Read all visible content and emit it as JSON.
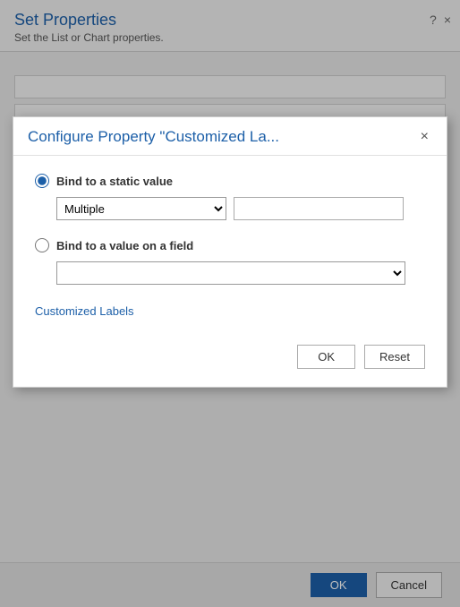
{
  "background": {
    "title": "Set Properties",
    "subtitle": "Set the List or Chart properties.",
    "help_icon": "?",
    "close_icon": "×",
    "ok_label": "OK",
    "cancel_label": "Cancel"
  },
  "modal": {
    "title": "Configure Property \"Customized La...",
    "close_icon": "×",
    "static_value_label": "Bind to a static value",
    "field_value_label": "Bind to a value on a field",
    "select_options": [
      "Multiple"
    ],
    "select_default": "Multiple",
    "text_input_placeholder": "",
    "field_select_placeholder": "",
    "customized_labels_link": "Customized Labels",
    "ok_label": "OK",
    "reset_label": "Reset"
  }
}
